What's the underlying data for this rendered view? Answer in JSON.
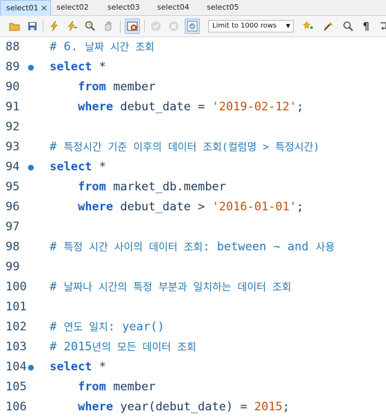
{
  "tabs": [
    {
      "label": "select01",
      "active": true,
      "closable": true
    },
    {
      "label": "select02",
      "active": false
    },
    {
      "label": "select03",
      "active": false
    },
    {
      "label": "select04",
      "active": false
    },
    {
      "label": "select05",
      "active": false
    }
  ],
  "toolbar": {
    "icons": [
      "open-folder",
      "save",
      "execute",
      "execute-current",
      "explain",
      "stop",
      "toggle-continue",
      "commit",
      "rollback",
      "auto-commit",
      "beautify",
      "find",
      "invisible-chars",
      "wrap"
    ],
    "limit_select": "Limit to 1000 rows"
  },
  "editor": {
    "lines": [
      {
        "n": "88",
        "fold": false,
        "tokens": [
          {
            "t": "cm",
            "v": "# 6. "
          },
          {
            "t": "cm-k",
            "v": "날짜 시간 조회"
          }
        ]
      },
      {
        "n": "89",
        "fold": true,
        "tokens": [
          {
            "t": "kw",
            "v": "select"
          },
          {
            "t": "op",
            "v": " *"
          }
        ]
      },
      {
        "n": "90",
        "fold": false,
        "tokens": [
          {
            "t": "op",
            "v": "    "
          },
          {
            "t": "kw",
            "v": "from"
          },
          {
            "t": "id",
            "v": " member"
          }
        ]
      },
      {
        "n": "91",
        "fold": false,
        "tokens": [
          {
            "t": "op",
            "v": "    "
          },
          {
            "t": "kw",
            "v": "where"
          },
          {
            "t": "id",
            "v": " debut_date = "
          },
          {
            "t": "str",
            "v": "'2019-02-12'"
          },
          {
            "t": "op",
            "v": ";"
          }
        ]
      },
      {
        "n": "92",
        "fold": false,
        "tokens": []
      },
      {
        "n": "93",
        "fold": false,
        "tokens": [
          {
            "t": "cm",
            "v": "# "
          },
          {
            "t": "cm-k",
            "v": "특정시간 기준 이후의 데이터 조회(컬럼명 > 특정시간)"
          }
        ]
      },
      {
        "n": "94",
        "fold": true,
        "tokens": [
          {
            "t": "kw",
            "v": "select"
          },
          {
            "t": "op",
            "v": " *"
          }
        ]
      },
      {
        "n": "95",
        "fold": false,
        "tokens": [
          {
            "t": "op",
            "v": "    "
          },
          {
            "t": "kw",
            "v": "from"
          },
          {
            "t": "id",
            "v": " market_db.member"
          }
        ]
      },
      {
        "n": "96",
        "fold": false,
        "tokens": [
          {
            "t": "op",
            "v": "    "
          },
          {
            "t": "kw",
            "v": "where"
          },
          {
            "t": "id",
            "v": " debut_date > "
          },
          {
            "t": "str",
            "v": "'2016-01-01'"
          },
          {
            "t": "op",
            "v": ";"
          }
        ]
      },
      {
        "n": "97",
        "fold": false,
        "tokens": []
      },
      {
        "n": "98",
        "fold": false,
        "tokens": [
          {
            "t": "cm",
            "v": "# "
          },
          {
            "t": "cm-k",
            "v": "특정 시간 사이의 데이터 조회"
          },
          {
            "t": "cm",
            "v": ": between ~ and "
          },
          {
            "t": "cm-k",
            "v": "사용"
          }
        ]
      },
      {
        "n": "99",
        "fold": false,
        "tokens": []
      },
      {
        "n": "100",
        "fold": false,
        "tokens": [
          {
            "t": "cm",
            "v": "# "
          },
          {
            "t": "cm-k",
            "v": "날짜나 시간의 특정 부분과 일치하는 데이터 조회"
          }
        ]
      },
      {
        "n": "101",
        "fold": false,
        "tokens": []
      },
      {
        "n": "102",
        "fold": false,
        "tokens": [
          {
            "t": "cm",
            "v": "# "
          },
          {
            "t": "cm-k",
            "v": "연도 일치"
          },
          {
            "t": "cm",
            "v": ": year()"
          }
        ]
      },
      {
        "n": "103",
        "fold": false,
        "tokens": [
          {
            "t": "cm",
            "v": "# 2015"
          },
          {
            "t": "cm-k",
            "v": "년의 모든 데이터 조회"
          }
        ]
      },
      {
        "n": "104",
        "fold": true,
        "tokens": [
          {
            "t": "kw",
            "v": "select"
          },
          {
            "t": "op",
            "v": " *"
          }
        ]
      },
      {
        "n": "105",
        "fold": false,
        "tokens": [
          {
            "t": "op",
            "v": "    "
          },
          {
            "t": "kw",
            "v": "from"
          },
          {
            "t": "id",
            "v": " member"
          }
        ]
      },
      {
        "n": "106",
        "fold": false,
        "tokens": [
          {
            "t": "op",
            "v": "    "
          },
          {
            "t": "kw",
            "v": "where"
          },
          {
            "t": "fn",
            "v": " year"
          },
          {
            "t": "op",
            "v": "(debut_date) = "
          },
          {
            "t": "num",
            "v": "2015"
          },
          {
            "t": "op",
            "v": ";"
          }
        ]
      }
    ]
  }
}
